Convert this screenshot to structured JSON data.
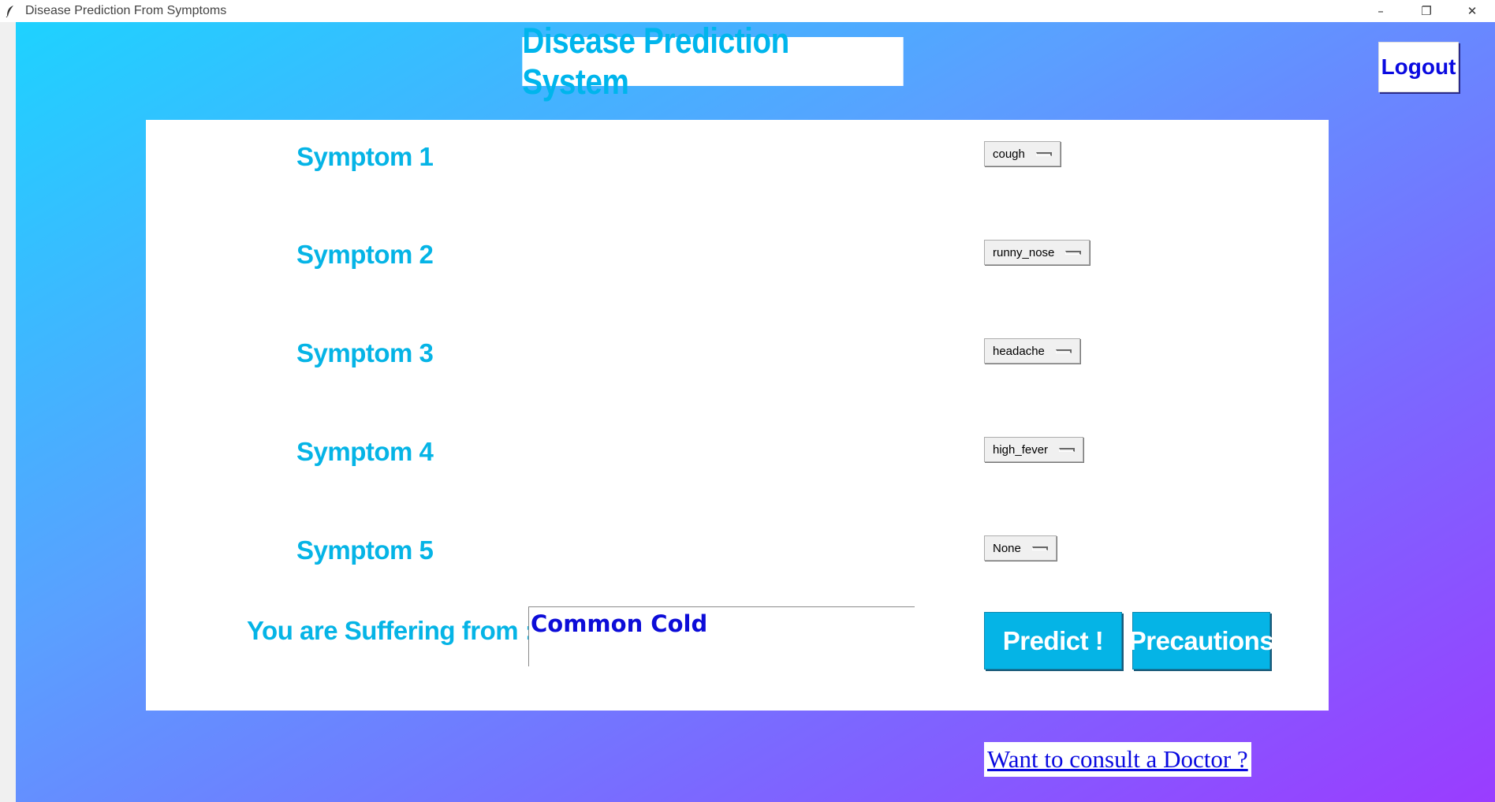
{
  "window": {
    "title": "Disease Prediction From Symptoms",
    "app_icon": "feather-icon",
    "controls": {
      "minimize": "–",
      "restore": "❐",
      "close": "✕"
    }
  },
  "header": {
    "title": "Disease Prediction System",
    "logout_label": "Logout"
  },
  "symptoms": [
    {
      "label": "Symptom 1",
      "value": "cough"
    },
    {
      "label": "Symptom 2",
      "value": "runny_nose"
    },
    {
      "label": "Symptom 3",
      "value": "headache"
    },
    {
      "label": "Symptom 4",
      "value": "high_fever"
    },
    {
      "label": "Symptom 5",
      "value": "None"
    }
  ],
  "result": {
    "label": "You are Suffering from :",
    "value": "Common Cold"
  },
  "actions": {
    "predict_label": "Predict !",
    "precautions_label": "Precautions"
  },
  "consult_link": "Want to consult a Doctor ?",
  "colors": {
    "accent": "#05b4e6",
    "link": "#0a0ae0",
    "result_text": "#0c0cd8"
  }
}
